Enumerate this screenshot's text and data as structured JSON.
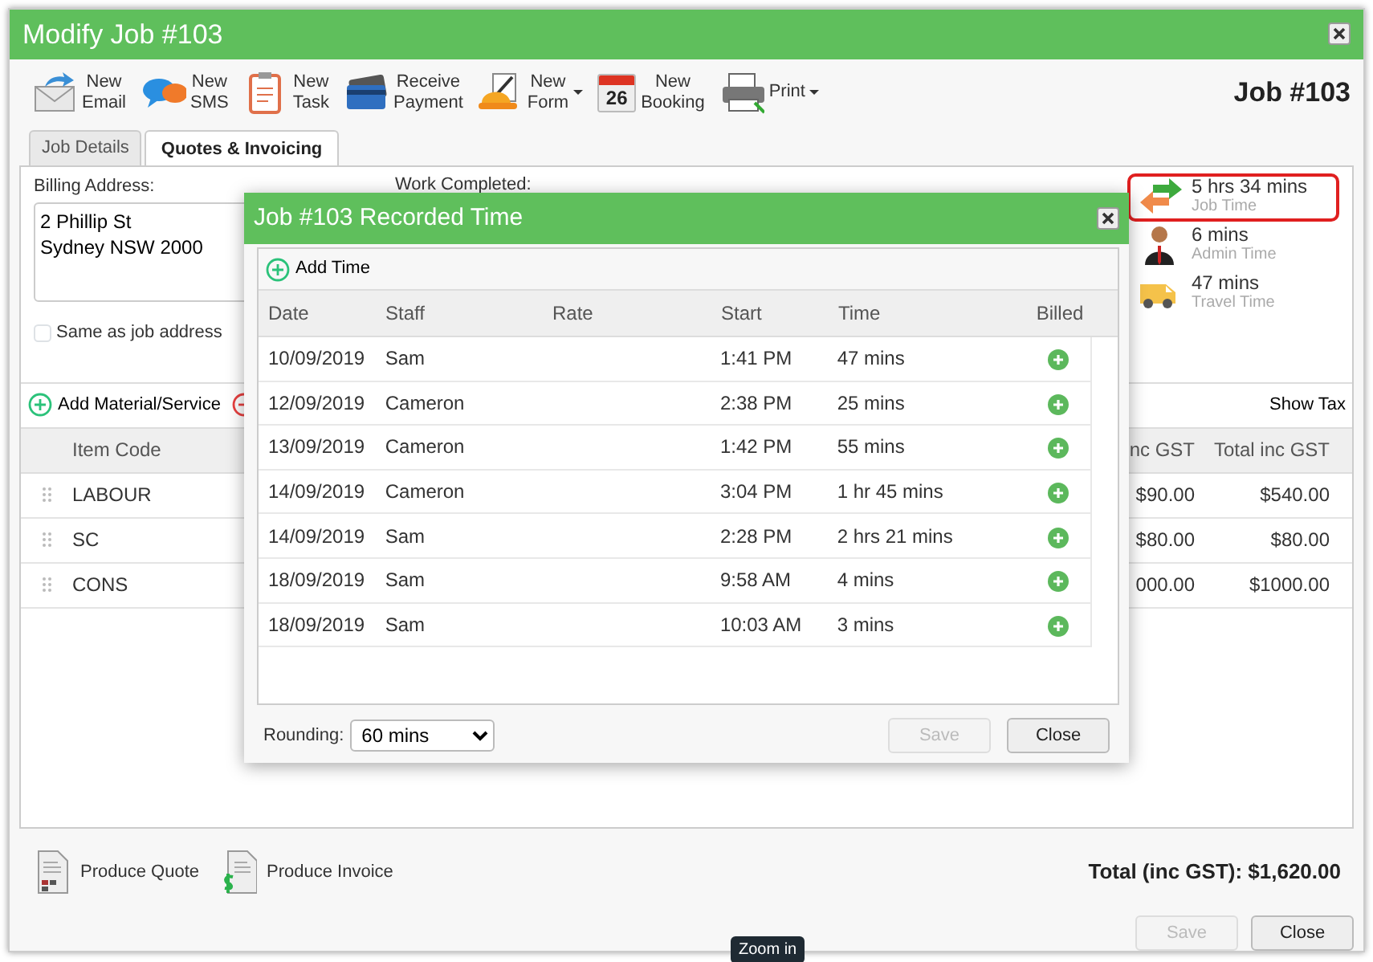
{
  "window": {
    "title": "Modify Job #103"
  },
  "toolbar": [
    {
      "kind": "email",
      "lines": [
        "New",
        "Email"
      ],
      "dropdown": false
    },
    {
      "kind": "sms",
      "lines": [
        "New",
        "SMS"
      ],
      "dropdown": false
    },
    {
      "kind": "task",
      "lines": [
        "New",
        "Task"
      ],
      "dropdown": false
    },
    {
      "kind": "payment",
      "lines": [
        "Receive",
        "Payment"
      ],
      "dropdown": false
    },
    {
      "kind": "form",
      "lines": [
        "New",
        "Form"
      ],
      "dropdown": true
    },
    {
      "kind": "booking",
      "lines": [
        "New",
        "Booking"
      ],
      "dropdown": false,
      "badge": "26"
    },
    {
      "kind": "print",
      "lines": [
        "Print"
      ],
      "dropdown": true
    }
  ],
  "job_number": "Job #103",
  "tabs": [
    {
      "label": "Job Details",
      "selected": false
    },
    {
      "label": "Quotes & Invoicing",
      "selected": true
    }
  ],
  "billing": {
    "label": "Billing Address:",
    "lines": [
      "2 Phillip St",
      "Sydney NSW 2000"
    ],
    "same_as_job": {
      "label": "Same as job address",
      "checked": false
    }
  },
  "work_completed_label": "Work Completed:",
  "time_summary": [
    {
      "kind": "job",
      "value": "5 hrs 34 mins",
      "label": "Job Time",
      "highlighted": true
    },
    {
      "kind": "admin",
      "value": "6 mins",
      "label": "Admin Time",
      "highlighted": false
    },
    {
      "kind": "travel",
      "value": "47 mins",
      "label": "Travel Time",
      "highlighted": false
    }
  ],
  "materials": {
    "add_label": "Add Material/Service",
    "show_tax": "Show Tax",
    "columns": [
      "Item Code",
      "nc GST",
      "Total inc GST"
    ],
    "rows": [
      [
        "LABOUR",
        "$90.00",
        "$540.00"
      ],
      [
        "SC",
        "$80.00",
        "$80.00"
      ],
      [
        "CONS",
        "000.00",
        "$1000.00"
      ]
    ]
  },
  "footer": {
    "actions": [
      {
        "kind": "quote",
        "label": "Produce Quote"
      },
      {
        "kind": "invoice",
        "label": "Produce Invoice"
      }
    ],
    "total": "Total (inc GST): $1,620.00",
    "buttons": [
      {
        "label": "Save",
        "disabled": true
      },
      {
        "label": "Close",
        "disabled": false
      }
    ]
  },
  "tooltip": "Zoom in",
  "modal": {
    "title": "Job #103 Recorded Time",
    "add_label": "Add Time",
    "columns": [
      "Date",
      "Staff",
      "Rate",
      "Start",
      "Time",
      "Billed"
    ],
    "rows": [
      {
        "date": "10/09/2019",
        "staff": "Sam",
        "start": "1:41 PM",
        "time": "47 mins"
      },
      {
        "date": "12/09/2019",
        "staff": "Cameron",
        "start": "2:38 PM",
        "time": "25 mins"
      },
      {
        "date": "13/09/2019",
        "staff": "Cameron",
        "start": "1:42 PM",
        "time": "55 mins"
      },
      {
        "date": "14/09/2019",
        "staff": "Cameron",
        "start": "3:04 PM",
        "time": "1 hr 45 mins"
      },
      {
        "date": "14/09/2019",
        "staff": "Sam",
        "start": "2:28 PM",
        "time": "2 hrs 21 mins"
      },
      {
        "date": "18/09/2019",
        "staff": "Sam",
        "start": "9:58 AM",
        "time": "4 mins"
      },
      {
        "date": "18/09/2019",
        "staff": "Sam",
        "start": "10:03 AM",
        "time": "3 mins"
      }
    ],
    "rounding": {
      "label": "Rounding:",
      "value": "60 mins"
    },
    "buttons": [
      {
        "label": "Save",
        "disabled": true
      },
      {
        "label": "Close",
        "disabled": false
      }
    ]
  }
}
